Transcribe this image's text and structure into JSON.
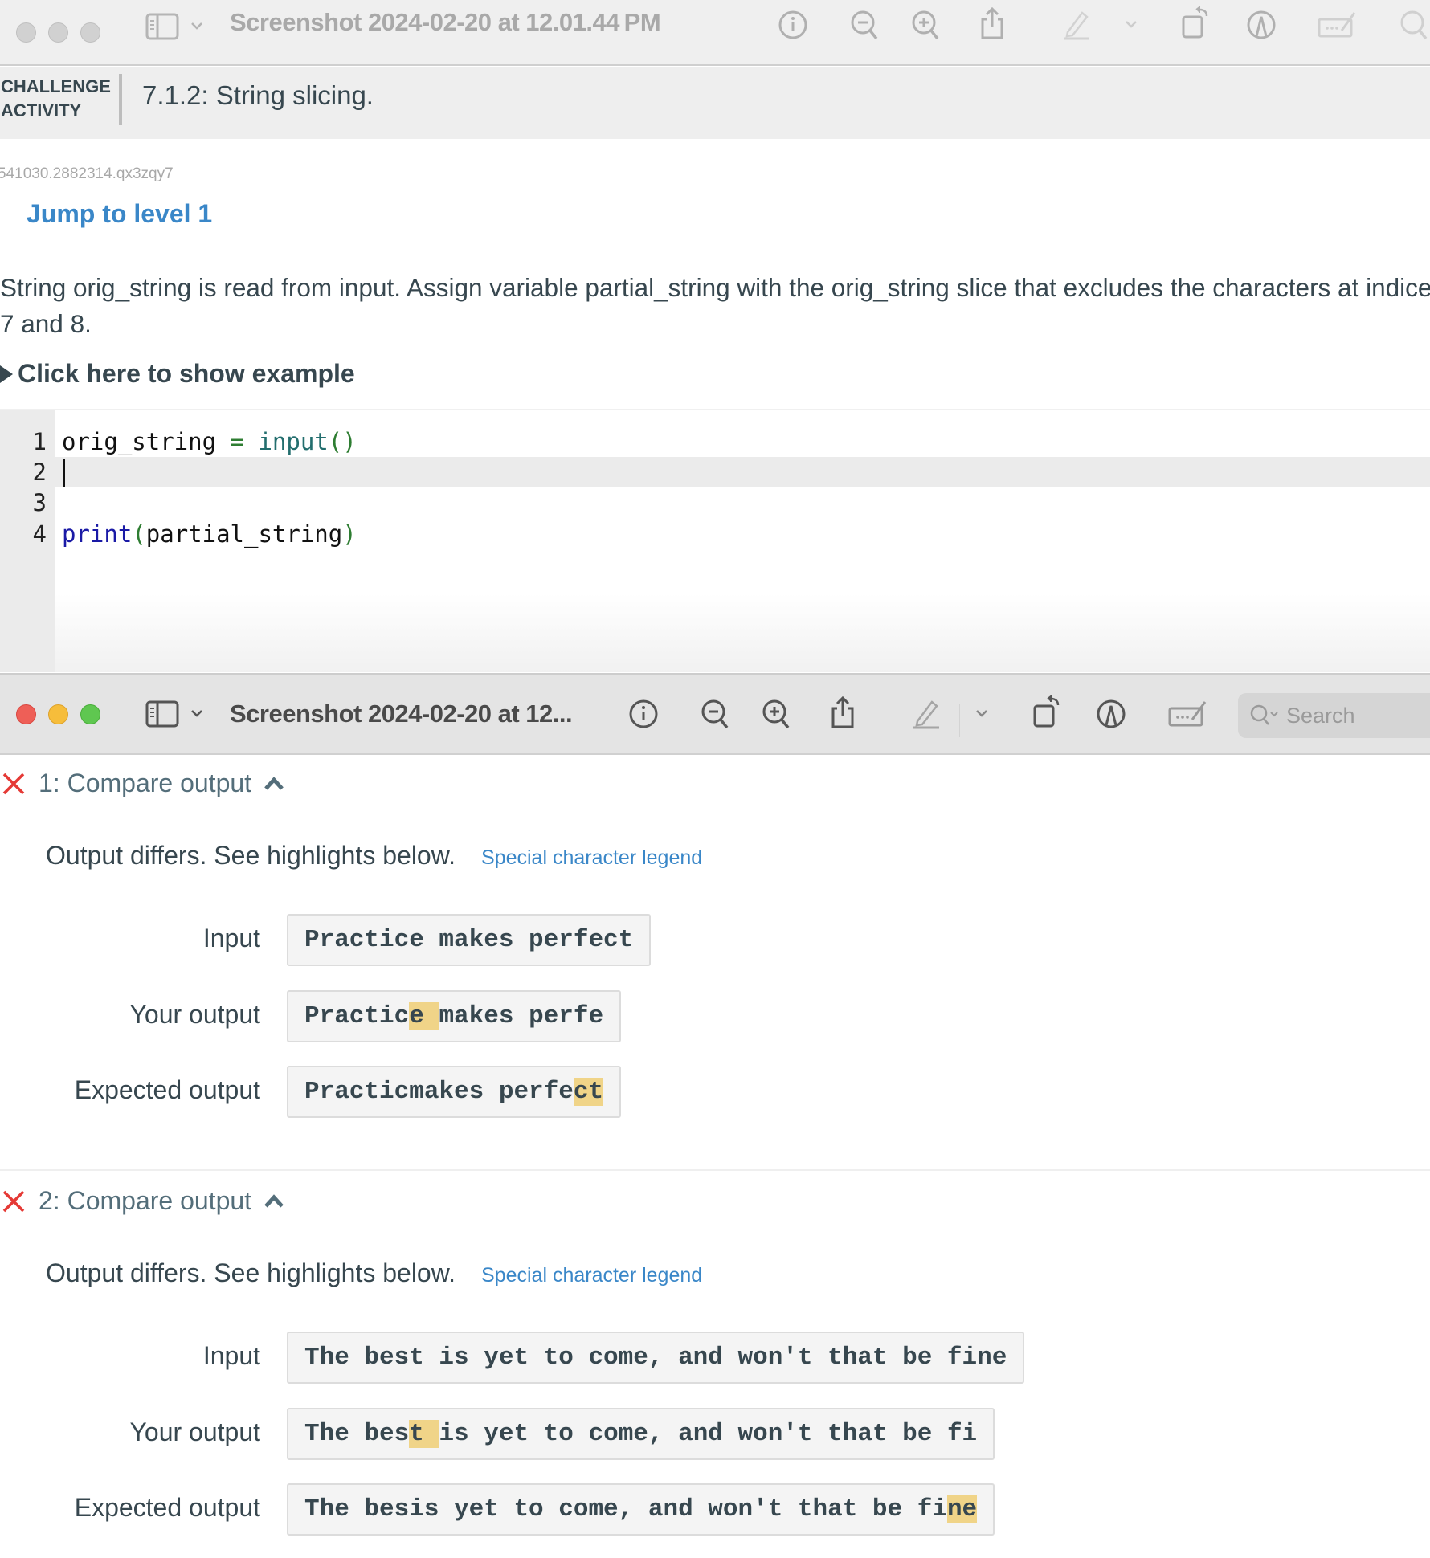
{
  "window_back": {
    "title": "Screenshot 2024-02-20 at 12.01.44 PM",
    "icons": [
      "sidebar-toggle-icon",
      "chevron-down-icon",
      "info-icon",
      "zoom-out-icon",
      "zoom-in-icon",
      "share-icon",
      "markup-pencil-icon",
      "chevron-down-icon",
      "rotate-icon",
      "annotate-icon",
      "sign-icon",
      "search-icon"
    ]
  },
  "window_front": {
    "title": "Screenshot 2024-02-20 at 12...",
    "search_placeholder": "Search",
    "icons": [
      "sidebar-toggle-icon",
      "chevron-down-icon",
      "info-icon",
      "zoom-out-icon",
      "zoom-in-icon",
      "share-icon",
      "markup-pencil-icon",
      "chevron-down-icon",
      "rotate-icon",
      "annotate-icon",
      "sign-icon"
    ]
  },
  "challenge": {
    "label_line1": "CHALLENGE",
    "label_line2": "ACTIVITY",
    "title": "7.1.2: String slicing.",
    "activity_id": "541030.2882314.qx3zqy7",
    "jump_link": "Jump to level 1",
    "description_line1": "String orig_string is read from input. Assign variable partial_string with the orig_string slice that excludes the characters at indice",
    "description_line2": "7 and 8.",
    "example_toggle": "Click here to show example"
  },
  "editor": {
    "lines": [
      {
        "number": "1",
        "tokens": [
          {
            "t": "orig_string",
            "c": "var"
          },
          {
            "t": " = ",
            "c": "op"
          },
          {
            "t": "input",
            "c": "builtin"
          },
          {
            "t": "()",
            "c": "paren"
          }
        ]
      },
      {
        "number": "2",
        "tokens": [],
        "active": true
      },
      {
        "number": "3",
        "tokens": []
      },
      {
        "number": "4",
        "tokens": [
          {
            "t": "print",
            "c": "kw"
          },
          {
            "t": "(",
            "c": "paren"
          },
          {
            "t": "partial_string",
            "c": "var"
          },
          {
            "t": ")",
            "c": "paren"
          }
        ]
      }
    ]
  },
  "tests": [
    {
      "title": "1: Compare output",
      "status": "failed",
      "message": "Output differs. See highlights below.",
      "legend_link": "Special character legend",
      "labels": {
        "input": "Input",
        "yours": "Your output",
        "expected": "Expected output"
      },
      "input": [
        {
          "t": "Practice makes perfect"
        }
      ],
      "your_output": [
        {
          "t": "Practic"
        },
        {
          "t": "e ",
          "hl": true
        },
        {
          "t": "makes perfe"
        }
      ],
      "expected_output": [
        {
          "t": "Practicmakes perfe"
        },
        {
          "t": "ct",
          "hl": true
        }
      ]
    },
    {
      "title": "2: Compare output",
      "status": "failed",
      "message": "Output differs. See highlights below.",
      "legend_link": "Special character legend",
      "labels": {
        "input": "Input",
        "yours": "Your output",
        "expected": "Expected output"
      },
      "input": [
        {
          "t": "The best is yet to come, and won't that be fine"
        }
      ],
      "your_output": [
        {
          "t": "The bes"
        },
        {
          "t": "t ",
          "hl": true
        },
        {
          "t": "is yet to come, and won't that be fi"
        }
      ],
      "expected_output": [
        {
          "t": "The besis yet to come, and won't that be fi"
        },
        {
          "t": "ne",
          "hl": true
        }
      ]
    }
  ],
  "colors": {
    "link": "#3a87c8",
    "fail": "#e53935",
    "highlight": "#f0d488",
    "text": "#37474f"
  }
}
